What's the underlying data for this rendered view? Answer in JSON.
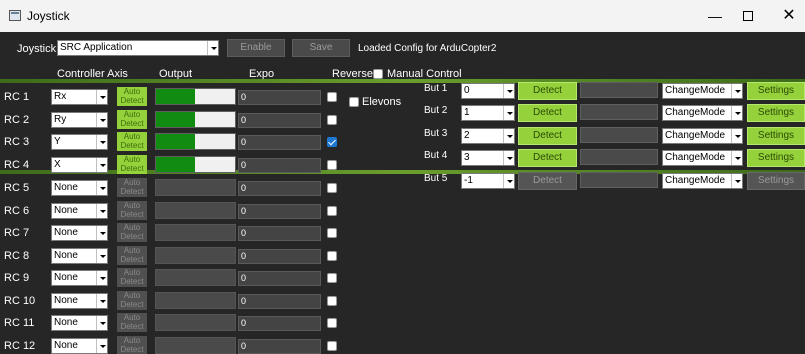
{
  "window": {
    "title": "Joystick"
  },
  "top": {
    "joystick_label": "Joystick",
    "joystick_select": "SRC Application",
    "enable_label": "Enable",
    "save_label": "Save",
    "status": "Loaded Config for ArduCopter2"
  },
  "headers": {
    "controller_axis": "Controller Axis",
    "output": "Output",
    "expo": "Expo",
    "reverse": "Reverse",
    "manual_control": "Manual Control",
    "elevons": "Elevons",
    "auto_detect": "Auto Detect"
  },
  "channels": [
    {
      "label": "RC 1",
      "axis": "Rx",
      "active": true,
      "output_fraction": 0.49,
      "expo": "0",
      "reverse": false
    },
    {
      "label": "RC 2",
      "axis": "Ry",
      "active": true,
      "output_fraction": 0.49,
      "expo": "0",
      "reverse": false
    },
    {
      "label": "RC 3",
      "axis": "Y",
      "active": true,
      "output_fraction": 0.49,
      "expo": "0",
      "reverse": true
    },
    {
      "label": "RC 4",
      "axis": "X",
      "active": true,
      "output_fraction": 0.49,
      "expo": "0",
      "reverse": false
    },
    {
      "label": "RC 5",
      "axis": "None",
      "active": false,
      "output_fraction": 0,
      "expo": "0",
      "reverse": false
    },
    {
      "label": "RC 6",
      "axis": "None",
      "active": false,
      "output_fraction": 0,
      "expo": "0",
      "reverse": false
    },
    {
      "label": "RC 7",
      "axis": "None",
      "active": false,
      "output_fraction": 0,
      "expo": "0",
      "reverse": false
    },
    {
      "label": "RC 8",
      "axis": "None",
      "active": false,
      "output_fraction": 0,
      "expo": "0",
      "reverse": false
    },
    {
      "label": "RC 9",
      "axis": "None",
      "active": false,
      "output_fraction": 0,
      "expo": "0",
      "reverse": false
    },
    {
      "label": "RC 10",
      "axis": "None",
      "active": false,
      "output_fraction": 0,
      "expo": "0",
      "reverse": false
    },
    {
      "label": "RC 11",
      "axis": "None",
      "active": false,
      "output_fraction": 0,
      "expo": "0",
      "reverse": false
    },
    {
      "label": "RC 12",
      "axis": "None",
      "active": false,
      "output_fraction": 0,
      "expo": "0",
      "reverse": false
    }
  ],
  "buttons": [
    {
      "label": "But 1",
      "value": "0",
      "active": true,
      "detect": "Detect",
      "mode": "ChangeMode",
      "settings": "Settings"
    },
    {
      "label": "But 2",
      "value": "1",
      "active": true,
      "detect": "Detect",
      "mode": "ChangeMode",
      "settings": "Settings"
    },
    {
      "label": "But 3",
      "value": "2",
      "active": true,
      "detect": "Detect",
      "mode": "ChangeMode",
      "settings": "Settings"
    },
    {
      "label": "But 4",
      "value": "3",
      "active": true,
      "detect": "Detect",
      "mode": "ChangeMode",
      "settings": "Settings"
    },
    {
      "label": "But 5",
      "value": "-1",
      "active": false,
      "detect": "Detect",
      "mode": "ChangeMode",
      "settings": "Settings"
    }
  ],
  "colors": {
    "accent_green": "#94d13a",
    "output_fill": "#118c11",
    "background": "#262626"
  }
}
